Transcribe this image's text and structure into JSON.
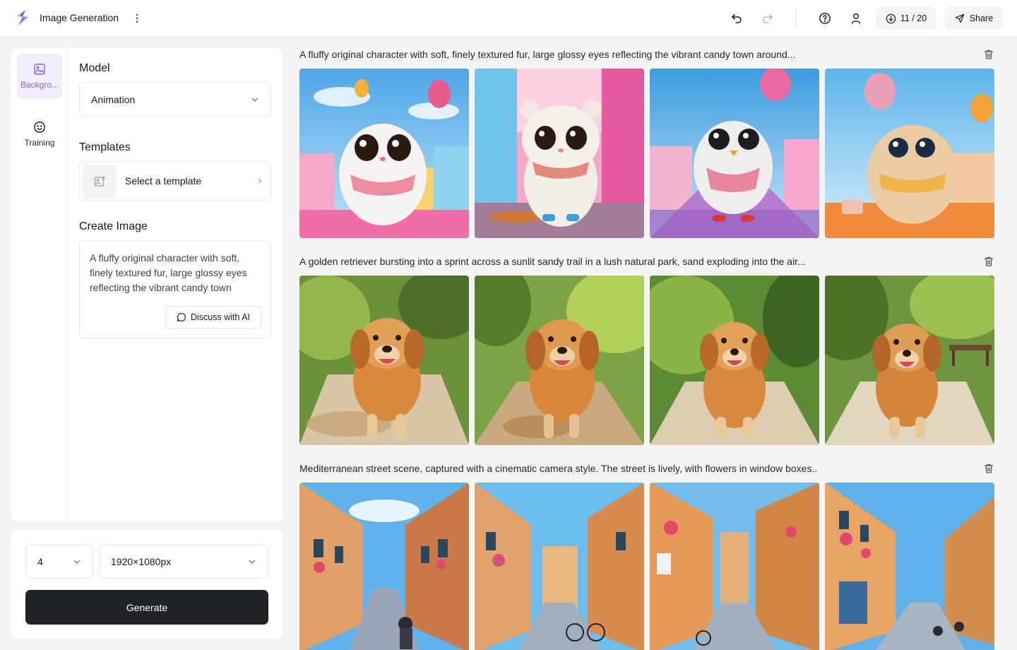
{
  "header": {
    "app_title": "Image Generation",
    "credits": "11 / 20",
    "share_label": "Share"
  },
  "rail": {
    "items": [
      {
        "label": "Backgro...",
        "icon": "image-icon",
        "active": true
      },
      {
        "label": "Training",
        "icon": "smiley-icon",
        "active": false
      }
    ]
  },
  "panel": {
    "model_title": "Model",
    "model_value": "Animation",
    "templates_title": "Templates",
    "template_placeholder": "Select a template",
    "create_title": "Create Image",
    "prompt_text": "A fluffy original character with soft, finely textured fur, large glossy eyes reflecting the vibrant candy town",
    "discuss_label": "Discuss with AI"
  },
  "bottom": {
    "count_value": "4",
    "size_value": "1920×1080px",
    "generate_label": "Generate"
  },
  "gallery": {
    "groups": [
      {
        "caption": "A fluffy original character with soft, finely textured fur, large glossy eyes reflecting the vibrant candy town around...",
        "theme": "candy"
      },
      {
        "caption": "A golden retriever bursting into a sprint across a sunlit sandy trail in a lush natural park, sand exploding into the air...",
        "theme": "dog"
      },
      {
        "caption": "Mediterranean street scene, captured with a cinematic camera style. The street is lively, with flowers in window boxes..",
        "theme": "street"
      }
    ]
  },
  "colors": {
    "accent": "#8b62c9",
    "accent_bg": "#f3eefc",
    "primary_button": "#1f2328"
  }
}
